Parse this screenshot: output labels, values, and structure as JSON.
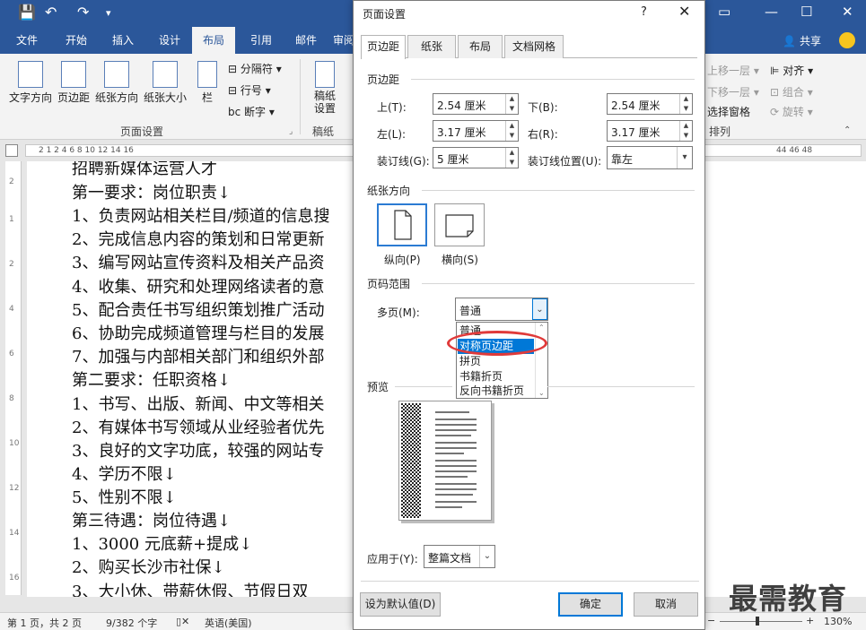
{
  "title_bar": {
    "qa_save": "save-icon",
    "qa_undo": "undo-icon",
    "qa_redo": "redo-icon"
  },
  "ribbon_tabs": [
    "文件",
    "开始",
    "插入",
    "设计",
    "布局",
    "引用",
    "邮件",
    "审阅"
  ],
  "active_tab": "布局",
  "share_label": "共享",
  "ribbon": {
    "text_direction": "文字方向",
    "margins": "页边距",
    "orientation": "纸张方向",
    "size": "纸张大小",
    "columns": "栏",
    "breaks": "分隔符",
    "line_numbers": "行号",
    "hyphenation": "断字",
    "page_setup_group": "页面设置",
    "draft_settings": "稿纸\n设置",
    "draft_group": "稿纸",
    "bring_forward": "上移一层",
    "send_backward": "下移一层",
    "selection_pane": "选择窗格",
    "align": "对齐",
    "group": "组合",
    "rotate": "旋转",
    "arrange_group": "排列"
  },
  "ruler_text": "2  1  2  4  6  8  10  12  14  16",
  "ruler_right": "44  46  48",
  "document_lines": [
    "招聘新媒体运营人才",
    "第一要求：岗位职责↓",
    "1、负责网站相关栏目/频道的信息搜",
    "2、完成信息内容的策划和日常更新",
    "3、编写网站宣传资料及相关产品资",
    "4、收集、研究和处理网络读者的意",
    "5、配合责任书写组织策划推广活动",
    "6、协助完成频道管理与栏目的发展",
    "7、加强与内部相关部门和组织外部",
    "第二要求：任职资格↓",
    "1、书写、出版、新闻、中文等相关",
    "2、有媒体书写领域从业经验者优先",
    "3、良好的文字功底，较强的网站专",
    "4、学历不限↓",
    "5、性别不限↓",
    "第三待遇：岗位待遇↓",
    "1、3000 元底薪+提成↓",
    "2、购买长沙市社保↓",
    "3、大小休、带薪休假、节假日双"
  ],
  "status": {
    "pages": "第 1 页，共 2 页",
    "words": "9/382 个字",
    "language": "英语(美国)",
    "zoom": "130%"
  },
  "dialog": {
    "title": "页面设置",
    "help": "?",
    "close": "✕",
    "tabs": [
      "页边距",
      "纸张",
      "布局",
      "文档网格"
    ],
    "active_tab": "页边距",
    "margins_section": "页边距",
    "top_label": "上(T):",
    "top_value": "2.54 厘米",
    "bottom_label": "下(B):",
    "bottom_value": "2.54 厘米",
    "left_label": "左(L):",
    "left_value": "3.17 厘米",
    "right_label": "右(R):",
    "right_value": "3.17 厘米",
    "gutter_label": "装订线(G):",
    "gutter_value": "5 厘米",
    "gutter_pos_label": "装订线位置(U):",
    "gutter_pos_value": "靠左",
    "orientation_section": "纸张方向",
    "portrait": "纵向(P)",
    "landscape": "横向(S)",
    "pages_section": "页码范围",
    "multiple_pages_label": "多页(M):",
    "multiple_pages_value": "普通",
    "multiple_pages_options": [
      "普通",
      "对称页边距",
      "拼页",
      "书籍折页",
      "反向书籍折页"
    ],
    "multiple_pages_highlighted": "对称页边距",
    "preview_section": "预览",
    "apply_to_label": "应用于(Y):",
    "apply_to_value": "整篇文档",
    "set_default": "设为默认值(D)",
    "ok": "确定",
    "cancel": "取消"
  },
  "watermark": "最需教育",
  "colors": {
    "accent": "#2b579a",
    "selection": "#0078d7",
    "annotation": "#e03a3a"
  }
}
